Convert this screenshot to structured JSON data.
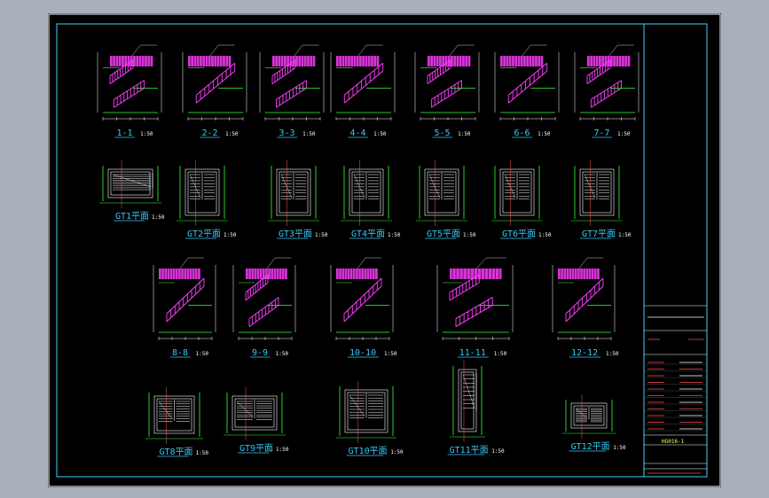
{
  "colors": {
    "background": "#a9b0bc",
    "sheet": "#000000",
    "frame": "#3fd0ff",
    "stair": "#ff3cff",
    "dimension": "#ffffff",
    "green": "#39ff39",
    "label": "#36c6f4",
    "titleblock_text": "#ff4d4d"
  },
  "sections_row1": [
    {
      "label": "1-1",
      "scale": "1:50"
    },
    {
      "label": "2-2",
      "scale": "1:50"
    },
    {
      "label": "3-3",
      "scale": "1:50"
    },
    {
      "label": "4-4",
      "scale": "1:50"
    },
    {
      "label": "5-5",
      "scale": "1:50"
    },
    {
      "label": "6-6",
      "scale": "1:50"
    },
    {
      "label": "7-7",
      "scale": "1:50"
    }
  ],
  "plans_row2": [
    {
      "label": "GT1平面",
      "scale": "1:50"
    },
    {
      "label": "GT2平面",
      "scale": "1:50"
    },
    {
      "label": "GT3平面",
      "scale": "1:50"
    },
    {
      "label": "GT4平面",
      "scale": "1:50"
    },
    {
      "label": "GT5平面",
      "scale": "1:50"
    },
    {
      "label": "GT6平面",
      "scale": "1:50"
    },
    {
      "label": "GT7平面",
      "scale": "1:50"
    }
  ],
  "sections_row3": [
    {
      "label": "8-8",
      "scale": "1:50"
    },
    {
      "label": "9-9",
      "scale": "1:50"
    },
    {
      "label": "10-10",
      "scale": "1:50"
    },
    {
      "label": "11-11",
      "scale": "1:50"
    },
    {
      "label": "12-12",
      "scale": "1:50"
    }
  ],
  "plans_row4": [
    {
      "label": "GT8平面",
      "scale": "1:50"
    },
    {
      "label": "GT9平面",
      "scale": "1:50"
    },
    {
      "label": "GT10平面",
      "scale": "1:50"
    },
    {
      "label": "GT11平面",
      "scale": "1:50"
    },
    {
      "label": "GT12平面",
      "scale": "1:50"
    }
  ],
  "title_block": {
    "drawing_number": "HG016-1"
  }
}
